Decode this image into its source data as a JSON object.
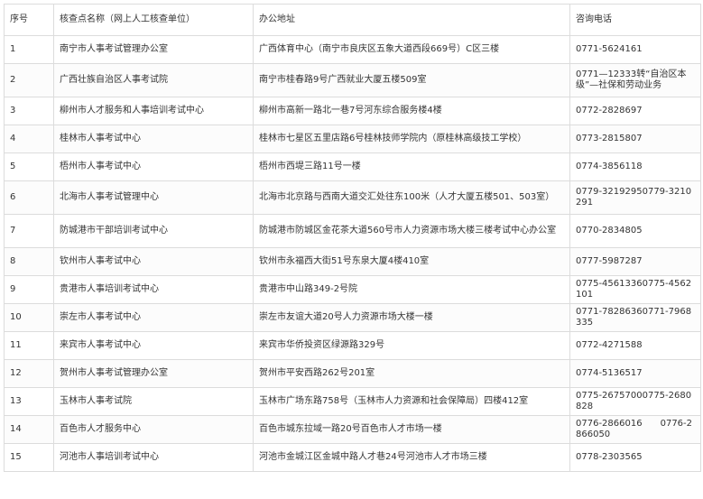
{
  "table": {
    "headers": [
      "序号",
      "核查点名称（网上人工核查单位）",
      "办公地址",
      "咨询电话"
    ],
    "rows": [
      {
        "no": "1",
        "name": "南宁市人事考试管理办公室",
        "address": "广西体育中心（南宁市良庆区五象大道西段669号）C区三楼",
        "phone": "0771-5624161"
      },
      {
        "no": "2",
        "name": "广西壮族自治区人事考试院",
        "address": "南宁市桂春路9号广西就业大厦五楼509室",
        "phone": "0771—12333转“自治区本级”—社保和劳动业务"
      },
      {
        "no": "3",
        "name": "柳州市人才服务和人事培训考试中心",
        "address": "柳州市高新一路北一巷7号河东综合服务楼4楼",
        "phone": "0772-2828697"
      },
      {
        "no": "4",
        "name": "桂林市人事考试中心",
        "address": "桂林市七星区五里店路6号桂林技师学院内（原桂林高级技工学校）",
        "phone": "0773-2815807"
      },
      {
        "no": "5",
        "name": "梧州市人事考试中心",
        "address": "梧州市西堤三路11号一楼",
        "phone": "0774-3856118"
      },
      {
        "no": "6",
        "name": "北海市人事考试管理中心",
        "address": "北海市北京路与西南大道交汇处往东100米（人才大厦五楼501、503室）",
        "phone": "0779-32192950779-3210291"
      },
      {
        "no": "7",
        "name": "防城港市干部培训考试中心",
        "address": "防城港市防城区金花茶大道560号市人力资源市场大楼三楼考试中心办公室",
        "phone": "0770-2834805"
      },
      {
        "no": "8",
        "name": "钦州市人事考试中心",
        "address": "钦州市永福西大街51号东泉大厦4楼410室",
        "phone": "0777-5987287"
      },
      {
        "no": "9",
        "name": "贵港市人事培训考试中心",
        "address": "贵港市中山路349-2号院",
        "phone": "0775-45613360775-4562101"
      },
      {
        "no": "10",
        "name": "崇左市人事考试中心",
        "address": "崇左市友谊大道20号人力资源市场大楼一楼",
        "phone": "0771-78286360771-7968335"
      },
      {
        "no": "11",
        "name": "来宾市人事考试中心",
        "address": "来宾市华侨投资区绿源路329号",
        "phone": "0772-4271588"
      },
      {
        "no": "12",
        "name": "贺州市人事考试管理办公室",
        "address": "贺州市平安西路262号201室",
        "phone": "0774-5136517"
      },
      {
        "no": "13",
        "name": "玉林市人事考试院",
        "address": "玉林市广场东路758号（玉林市人力资源和社会保障局）四楼412室",
        "phone": "0775-26757000775-2680828"
      },
      {
        "no": "14",
        "name": "百色市人才服务中心",
        "address": "百色市城东拉域一路20号百色市人才市场一楼",
        "phone": "0776-2866016　　0776-2866050"
      },
      {
        "no": "15",
        "name": "河池市人事培训考试中心",
        "address": "河池市金城江区金城中路人才巷24号河池市人才市场三楼",
        "phone": "0778-2303565"
      }
    ]
  }
}
